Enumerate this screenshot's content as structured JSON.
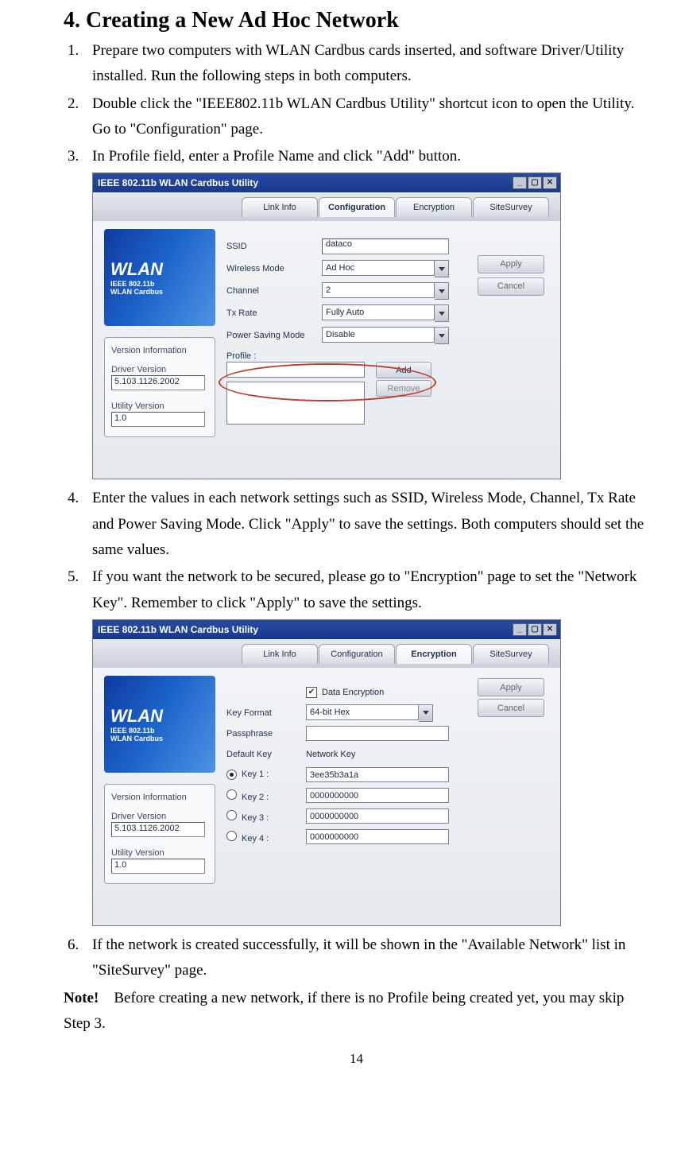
{
  "heading": "4. Creating a New Ad Hoc Network",
  "steps": [
    "Prepare two computers with WLAN Cardbus cards inserted, and software Driver/Utility installed.  Run the following steps in both computers.",
    "Double click the \"IEEE802.11b WLAN Cardbus Utility\" shortcut icon to open the Utility.   Go to \"Configuration\" page.",
    "In Profile field, enter a Profile Name and click \"Add\" button.",
    "Enter the values in each network settings such as SSID, Wireless Mode, Channel, Tx Rate and Power Saving Mode.    Click \"Apply\" to save the settings.    Both computers should set the same values.",
    "If you want the network to be secured, please go to \"Encryption\" page to set the \"Network Key\".    Remember to click \"Apply\" to save the settings.",
    "If the network is created successfully, it will be shown in the \"Available Network\" list in \"SiteSurvey\" page."
  ],
  "note_label": "Note!",
  "note_text": "Before creating a new network, if there is no Profile being created yet, you may skip Step 3.",
  "page_number": "14",
  "util": {
    "title": "IEEE 802.11b WLAN Cardbus Utility",
    "tabs": [
      "Link Info",
      "Configuration",
      "Encryption",
      "SiteSurvey"
    ],
    "logo": {
      "big": "WLAN",
      "l1": "IEEE 802.11b",
      "l2": "WLAN Cardbus"
    },
    "version": {
      "header": "Version Information",
      "driver_label": "Driver Version",
      "driver_value": "5.103.1126.2002",
      "utility_label": "Utility Version",
      "utility_value": "1.0"
    },
    "buttons": {
      "apply": "Apply",
      "cancel": "Cancel",
      "add": "Add",
      "remove": "Remove"
    },
    "config": {
      "ssid_label": "SSID",
      "ssid_value": "dataco",
      "mode_label": "Wireless Mode",
      "mode_value": "Ad Hoc",
      "channel_label": "Channel",
      "channel_value": "2",
      "txrate_label": "Tx Rate",
      "txrate_value": "Fully Auto",
      "psm_label": "Power Saving Mode",
      "psm_value": "Disable",
      "profile_label": "Profile :"
    },
    "enc": {
      "data_enc_label": "Data Encryption",
      "keyfmt_label": "Key Format",
      "keyfmt_value": "64-bit Hex",
      "pass_label": "Passphrase",
      "defkey_label": "Default Key",
      "netkey_label": "Network Key",
      "keys": [
        {
          "label": "Key 1 :",
          "value": "3ee35b3a1a",
          "sel": true
        },
        {
          "label": "Key 2 :",
          "value": "0000000000",
          "sel": false
        },
        {
          "label": "Key 3 :",
          "value": "0000000000",
          "sel": false
        },
        {
          "label": "Key 4 :",
          "value": "0000000000",
          "sel": false
        }
      ]
    }
  }
}
